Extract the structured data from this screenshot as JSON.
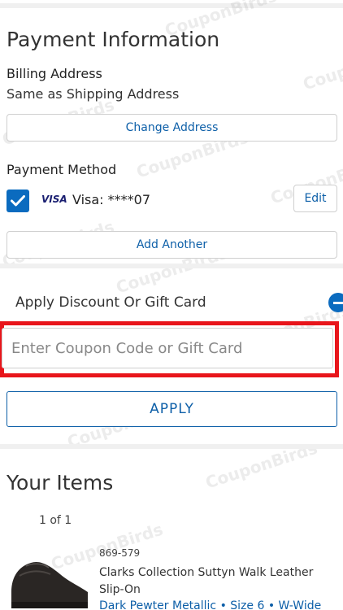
{
  "payment": {
    "title": "Payment Information",
    "billing_label": "Billing Address",
    "billing_value": "Same as Shipping Address",
    "change_address": "Change Address",
    "method_label": "Payment Method",
    "visa_logo": "VISA",
    "card_text": "Visa: ****07",
    "edit": "Edit",
    "add_another": "Add Another"
  },
  "discount": {
    "title": "Apply Discount Or Gift Card",
    "placeholder": "Enter Coupon Code or Gift Card",
    "apply": "APPLY"
  },
  "items": {
    "title": "Your Items",
    "count": "1 of 1",
    "product": {
      "sku": "869-579",
      "name": "Clarks Collection Suttyn Walk Leather Slip-On",
      "variant": "Dark Pewter Metallic • Size 6 • W-Wide"
    }
  },
  "watermark": "CouponBirds",
  "colors": {
    "accent": "#0d5fa8",
    "checkbox": "#0b6bbf",
    "highlight": "#e8151b"
  }
}
